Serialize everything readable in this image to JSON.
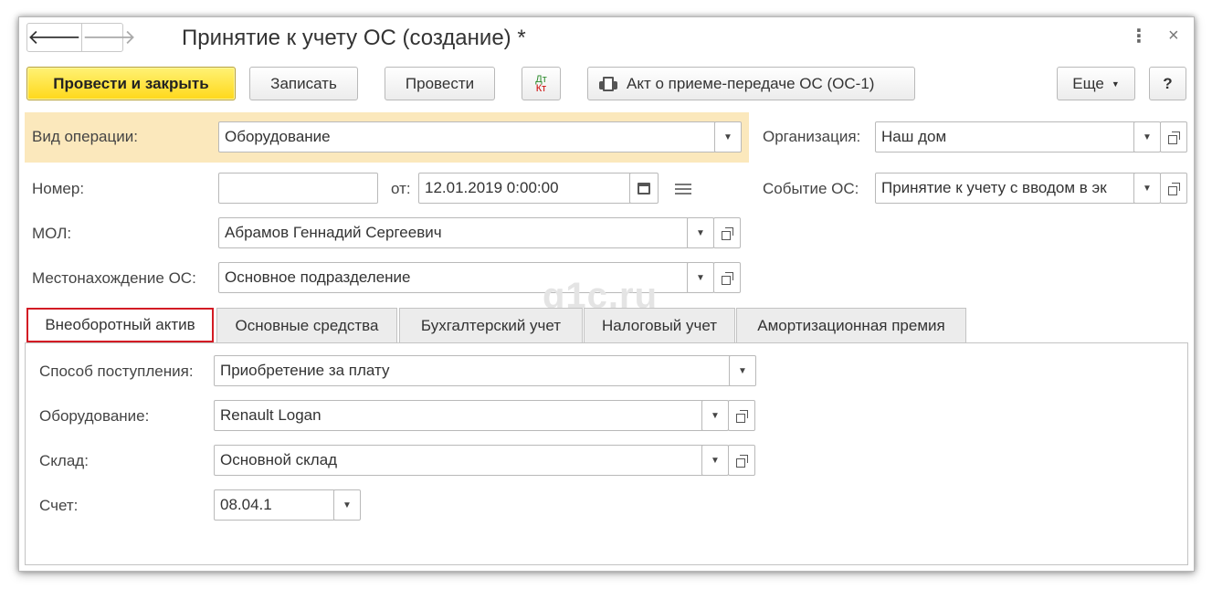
{
  "window": {
    "title": "Принятие к учету ОС (создание) *"
  },
  "nav": {
    "back": "🡐",
    "forward": "🡒",
    "more": "⋮",
    "close": "×"
  },
  "toolbar": {
    "post_and_close": "Провести и закрыть",
    "save": "Записать",
    "post": "Провести",
    "dt": "Дт",
    "kt": "Кт",
    "act_print": "Акт о приеме-передаче ОС (ОС-1)",
    "more": "Еще",
    "help": "?"
  },
  "form": {
    "operation_type": {
      "label": "Вид операции:",
      "value": "Оборудование"
    },
    "organization": {
      "label": "Организация:",
      "value": "Наш дом"
    },
    "number": {
      "label": "Номер:",
      "value": ""
    },
    "date": {
      "label": "от:",
      "value": "12.01.2019  0:00:00"
    },
    "event": {
      "label": "Событие ОС:",
      "value": "Принятие к учету с вводом в эк"
    },
    "mol": {
      "label": "МОЛ:",
      "value": "Абрамов Геннадий Сергеевич"
    },
    "location": {
      "label": "Местонахождение ОС:",
      "value": "Основное подразделение"
    }
  },
  "watermark": "q1c.ru",
  "tabs": [
    {
      "label": "Внеоборотный актив",
      "active": true
    },
    {
      "label": "Основные средства",
      "active": false
    },
    {
      "label": "Бухгалтерский учет",
      "active": false
    },
    {
      "label": "Налоговый учет",
      "active": false
    },
    {
      "label": "Амортизационная премия",
      "active": false
    }
  ],
  "tab_content": {
    "receipt_method": {
      "label": "Способ поступления:",
      "value": "Приобретение за плату"
    },
    "equipment": {
      "label": "Оборудование:",
      "value": "Renault Logan"
    },
    "warehouse": {
      "label": "Склад:",
      "value": "Основной склад"
    },
    "account": {
      "label": "Счет:",
      "value": "08.04.1"
    }
  },
  "colors": {
    "primary_button": "#ffd81a",
    "highlight_row": "#fbe8bc",
    "active_tab_border": "#d31b24"
  }
}
